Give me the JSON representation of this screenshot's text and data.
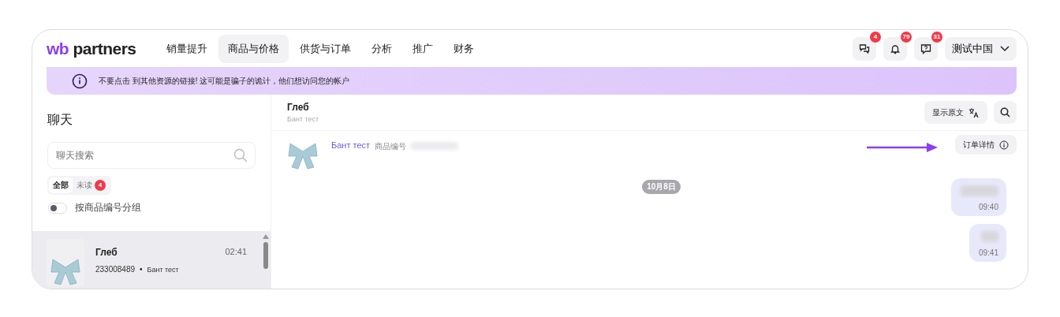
{
  "logo": {
    "prefix": "wb",
    "name": "partners"
  },
  "nav": [
    {
      "label": "销量提升",
      "selected": false
    },
    {
      "label": "商品与价格",
      "selected": true
    },
    {
      "label": "供货与订单",
      "selected": false
    },
    {
      "label": "分析",
      "selected": false
    },
    {
      "label": "推广",
      "selected": false
    },
    {
      "label": "财务",
      "selected": false
    }
  ],
  "header_icons": [
    {
      "kind": "chat",
      "badge": "4"
    },
    {
      "kind": "bell",
      "badge": "79"
    },
    {
      "kind": "help",
      "badge": "31"
    }
  ],
  "account": {
    "label": "测试中国"
  },
  "banner": {
    "text": "不要点击 到其他资源的链接! 这可能是骗子的诡计，他们想访问您的帐户"
  },
  "sidebar": {
    "title": "聊天",
    "search": {
      "placeholder": "聊天搜索"
    },
    "filters": [
      {
        "label": "全部",
        "selected": true
      },
      {
        "label": "未读",
        "selected": false,
        "badge": "4"
      }
    ],
    "group_toggle": {
      "label": "按商品编号分组",
      "on": false
    },
    "chats": [
      {
        "name": "Глеб",
        "time": "02:41",
        "article": "233008489",
        "separator": "•",
        "product": "Бант тест",
        "selected": true
      }
    ]
  },
  "conversation": {
    "name": "Глеб",
    "subtitle": "Бант тест",
    "show_original_button": "显示原文",
    "product": {
      "name": "Бант тест",
      "article_label": "商品编号"
    },
    "order_details_button": "订单详情",
    "date": "10月8日",
    "messages": [
      {
        "time": "09:40"
      },
      {
        "time": "09:41"
      }
    ]
  }
}
